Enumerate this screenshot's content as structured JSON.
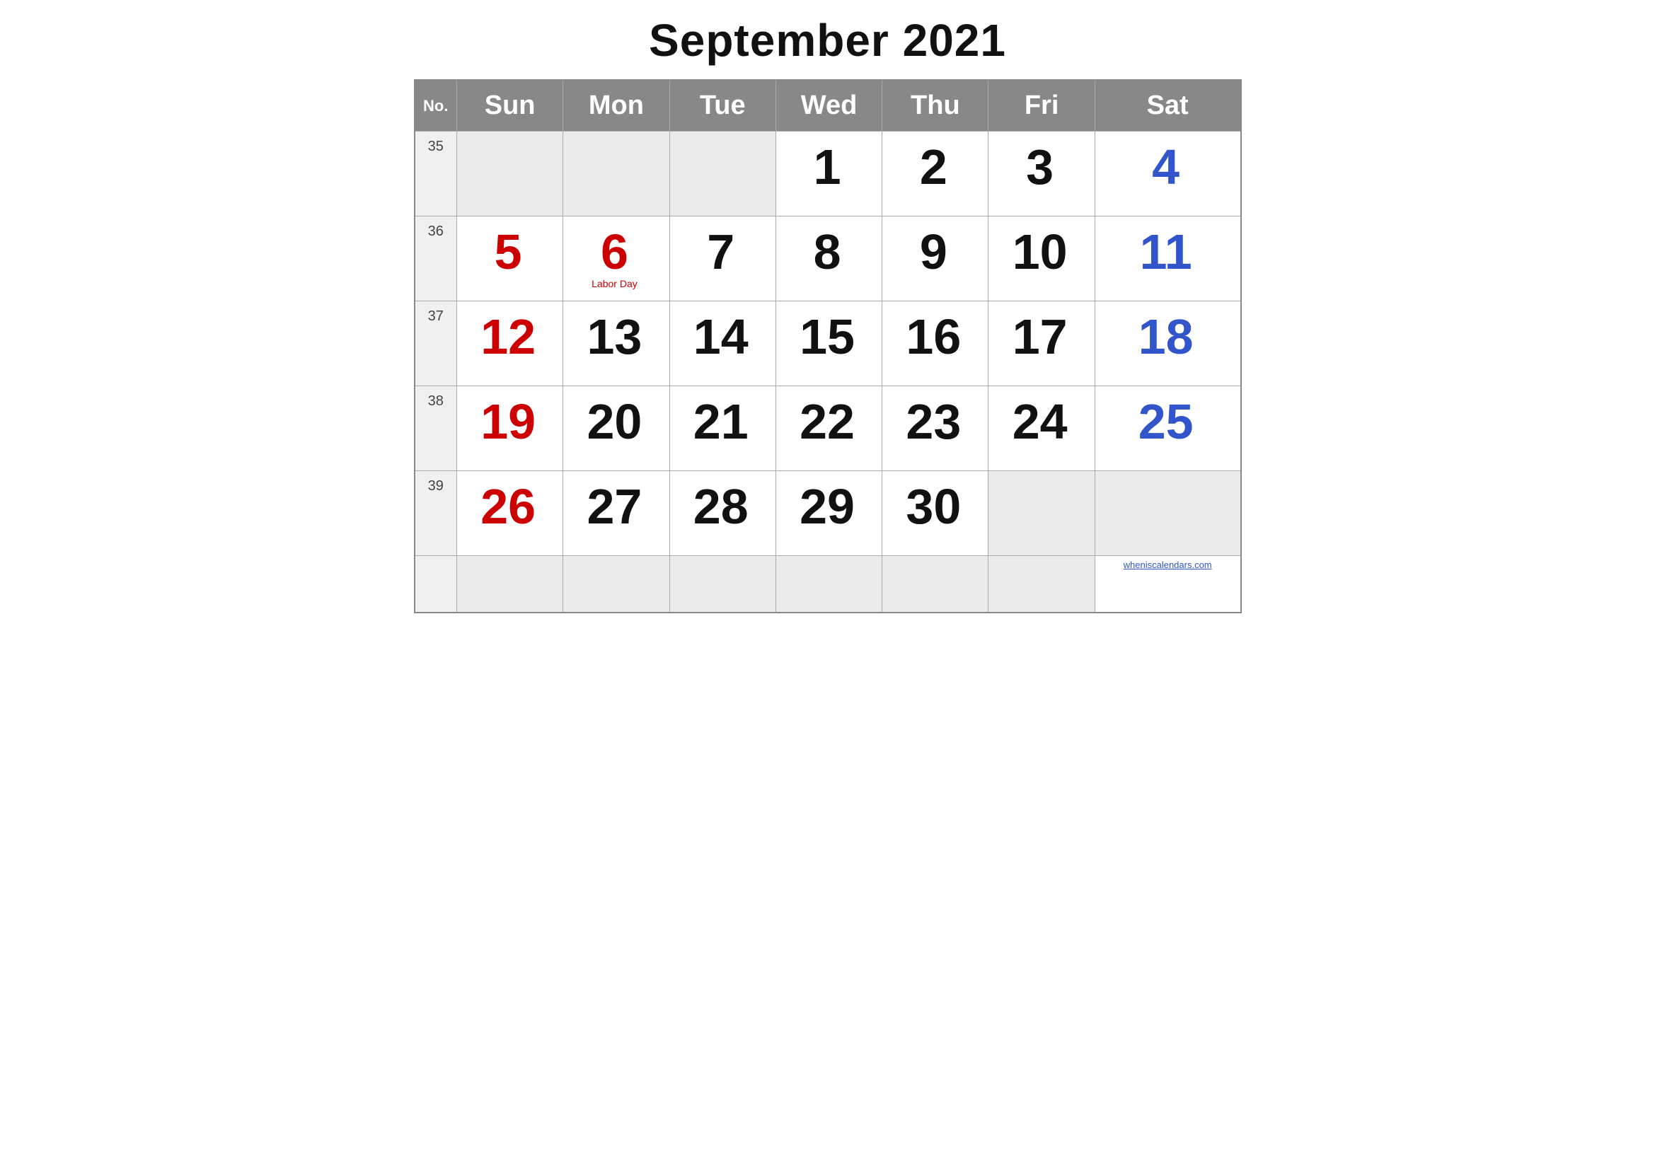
{
  "title": "September 2021",
  "headers": {
    "no": "No.",
    "sun": "Sun",
    "mon": "Mon",
    "tue": "Tue",
    "wed": "Wed",
    "thu": "Thu",
    "fri": "Fri",
    "sat": "Sat"
  },
  "weeks": [
    {
      "week_num": "35",
      "days": [
        {
          "date": "",
          "color": "empty"
        },
        {
          "date": "",
          "color": "empty"
        },
        {
          "date": "",
          "color": "empty"
        },
        {
          "date": "1",
          "color": "black"
        },
        {
          "date": "2",
          "color": "black"
        },
        {
          "date": "3",
          "color": "black"
        },
        {
          "date": "4",
          "color": "blue"
        }
      ]
    },
    {
      "week_num": "36",
      "days": [
        {
          "date": "5",
          "color": "red"
        },
        {
          "date": "6",
          "color": "red",
          "holiday": "Labor Day"
        },
        {
          "date": "7",
          "color": "black"
        },
        {
          "date": "8",
          "color": "black"
        },
        {
          "date": "9",
          "color": "black"
        },
        {
          "date": "10",
          "color": "black"
        },
        {
          "date": "11",
          "color": "blue"
        }
      ]
    },
    {
      "week_num": "37",
      "days": [
        {
          "date": "12",
          "color": "red"
        },
        {
          "date": "13",
          "color": "black"
        },
        {
          "date": "14",
          "color": "black"
        },
        {
          "date": "15",
          "color": "black"
        },
        {
          "date": "16",
          "color": "black"
        },
        {
          "date": "17",
          "color": "black"
        },
        {
          "date": "18",
          "color": "blue"
        }
      ]
    },
    {
      "week_num": "38",
      "days": [
        {
          "date": "19",
          "color": "red"
        },
        {
          "date": "20",
          "color": "black"
        },
        {
          "date": "21",
          "color": "black"
        },
        {
          "date": "22",
          "color": "black"
        },
        {
          "date": "23",
          "color": "black"
        },
        {
          "date": "24",
          "color": "black"
        },
        {
          "date": "25",
          "color": "blue"
        }
      ]
    },
    {
      "week_num": "39",
      "days": [
        {
          "date": "26",
          "color": "red"
        },
        {
          "date": "27",
          "color": "black"
        },
        {
          "date": "28",
          "color": "black"
        },
        {
          "date": "29",
          "color": "black"
        },
        {
          "date": "30",
          "color": "black"
        },
        {
          "date": "",
          "color": "empty"
        },
        {
          "date": "",
          "color": "empty"
        }
      ]
    }
  ],
  "last_row": {
    "days": [
      {
        "color": "empty"
      },
      {
        "color": "empty"
      },
      {
        "color": "empty"
      },
      {
        "color": "empty"
      },
      {
        "color": "empty"
      },
      {
        "color": "empty"
      },
      {
        "color": "watermark",
        "text": "wheniscalendars.com"
      }
    ]
  },
  "watermark": "wheniscalendars.com"
}
